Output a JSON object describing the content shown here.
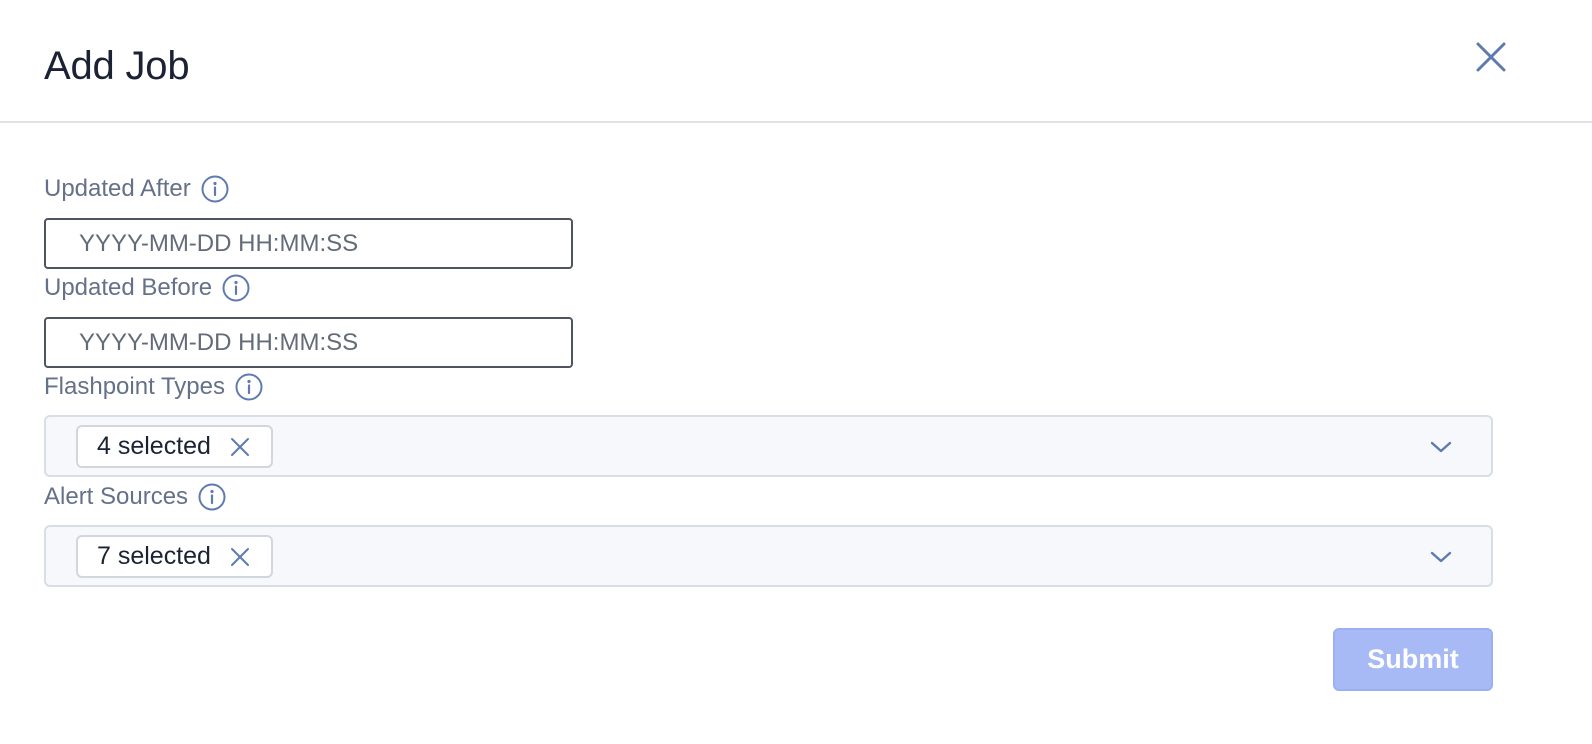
{
  "dialog": {
    "title": "Add Job",
    "close_icon": "close-icon"
  },
  "fields": {
    "updated_after": {
      "label": "Updated After",
      "placeholder": "YYYY-MM-DD HH:MM:SS",
      "value": "",
      "icon": "info-icon"
    },
    "updated_before": {
      "label": "Updated Before",
      "placeholder": "YYYY-MM-DD HH:MM:SS",
      "value": "",
      "icon": "info-icon"
    },
    "flashpoint_types": {
      "label": "Flashpoint Types",
      "chip": "4 selected",
      "icon": "info-icon",
      "dropdown_icon": "chevron-down-icon"
    },
    "alert_sources": {
      "label": "Alert Sources",
      "chip": "7 selected",
      "icon": "info-icon",
      "dropdown_icon": "chevron-down-icon"
    }
  },
  "actions": {
    "submit_label": "Submit",
    "submit_disabled": true
  },
  "colors": {
    "title_text": "#1b2233",
    "label_text": "#657089",
    "icon": "#5f7ab0",
    "submit_bg": "#a8baf6",
    "submit_text": "#ffffff",
    "select_bg": "#f7f8fb"
  }
}
